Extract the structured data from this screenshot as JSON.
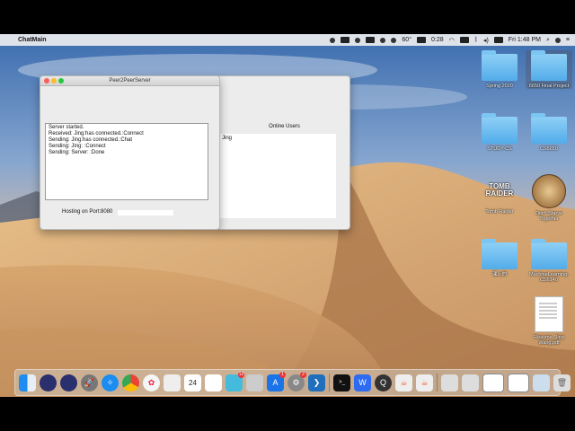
{
  "menubar": {
    "app_name": "ChatMain",
    "temperature": "60°",
    "battery_time": "0:28",
    "clock": "Fri 1:48 PM"
  },
  "server_window": {
    "title": "Peer2PeerServer",
    "log_lines": [
      "Server started.",
      "Received: Jing:has connected.:Connect",
      "Sending: Jing:has connected.:Chat",
      "Sending: Jing: :Connect",
      "Sending: Server: :Done"
    ],
    "hosting_label": "Hosting on Port:8080"
  },
  "users_window": {
    "title": "Online Users",
    "users": [
      "Jing"
    ]
  },
  "desktop_icons": [
    {
      "label": "Spring 2020",
      "icon": "folder-icon"
    },
    {
      "label": "6650 Final Project",
      "icon": "folder-icon"
    },
    {
      "label": "STUDY-CS",
      "icon": "folder-icon"
    },
    {
      "label": "CS6650",
      "icon": "folder-icon"
    },
    {
      "label": "Tomb Raider",
      "icon": "tomb-raider-icon",
      "art_text": "TOMB RAIDER"
    },
    {
      "label": "Don't Starve Together",
      "icon": "dont-starve-icon"
    },
    {
      "label": "课上的",
      "icon": "folder-icon"
    },
    {
      "label": "MachineLearning-CS6140",
      "icon": "folder-icon"
    },
    {
      "label": "Resume_Jing Wang.pdf",
      "icon": "pdf-file-icon"
    }
  ],
  "dock": {
    "calendar_date": "24",
    "badges": {
      "messages": "12",
      "app_store": "1",
      "preferences": "2"
    }
  },
  "colors": {
    "folder": "#52acea",
    "close": "#fc5f57",
    "minimize": "#fdbc2e",
    "maximize": "#28c840"
  }
}
